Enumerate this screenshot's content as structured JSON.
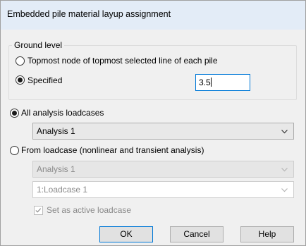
{
  "dialog": {
    "title": "Embedded pile material layup assignment"
  },
  "ground_level": {
    "group_label": "Ground level",
    "option_topmost": "Topmost node of topmost selected line of each pile",
    "option_specified": "Specified",
    "specified_value": "3.5",
    "selected": "specified"
  },
  "analysis": {
    "option_all": "All analysis loadcases",
    "all_combo_value": "Analysis 1",
    "option_from": "From loadcase (nonlinear and transient analysis)",
    "from_analysis_value": "Analysis 1",
    "from_loadcase_value": "1:Loadcase 1",
    "active_checkbox_label": "Set as active loadcase",
    "active_checked": true,
    "selected": "all"
  },
  "buttons": {
    "ok": "OK",
    "cancel": "Cancel",
    "help": "Help"
  },
  "icons": {
    "combo_arrow": "chevron-down-icon",
    "check": "check-icon"
  },
  "colors": {
    "title_bg": "#e3ecf7",
    "focus_border": "#0078d7",
    "disabled_text": "#8a8a8a"
  }
}
